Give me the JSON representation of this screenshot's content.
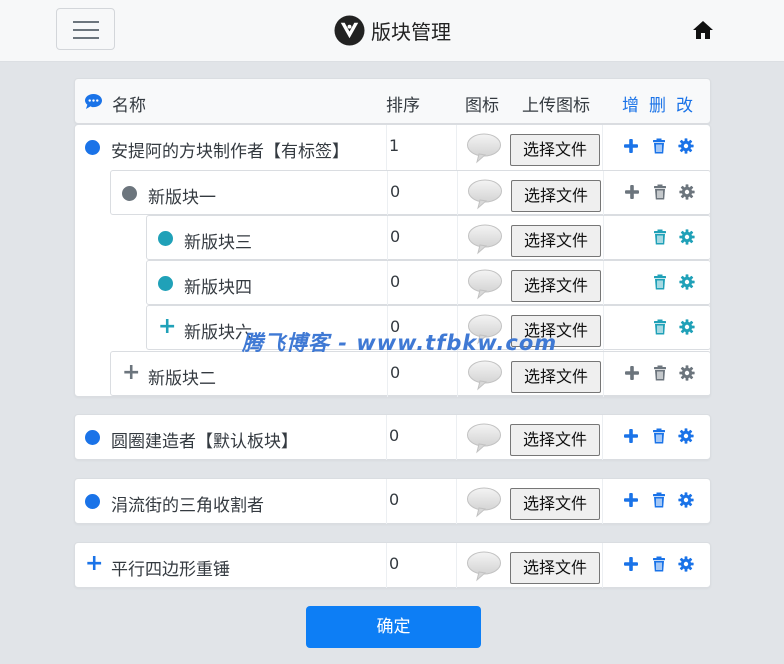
{
  "header": {
    "title": "版块管理"
  },
  "table_head": {
    "name": "名称",
    "order": "排序",
    "icon": "图标",
    "upload": "上传图标",
    "add": "增",
    "delete": "删",
    "edit": "改"
  },
  "rows": [
    {
      "name": "安提阿的方块制作者【有标签】",
      "order": "1",
      "file_label": "选择文件",
      "marker_color": "#1a73e8"
    },
    {
      "name": "新版块一",
      "order": "0",
      "file_label": "选择文件",
      "marker_color": "#6c757d"
    },
    {
      "name": "新版块三",
      "order": "0",
      "file_label": "选择文件",
      "marker_color": "#20a1b8"
    },
    {
      "name": "新版块四",
      "order": "0",
      "file_label": "选择文件",
      "marker_color": "#20a1b8"
    },
    {
      "name": "新版块六",
      "order": "0",
      "file_label": "选择文件",
      "marker_color": "#20a1b8"
    },
    {
      "name": "新版块二",
      "order": "0",
      "file_label": "选择文件",
      "marker_color": "#6c757d"
    },
    {
      "name": "圆圈建造者【默认板块】",
      "order": "0",
      "file_label": "选择文件",
      "marker_color": "#1a73e8"
    },
    {
      "name": "涓流街的三角收割者",
      "order": "0",
      "file_label": "选择文件",
      "marker_color": "#1a73e8"
    },
    {
      "name": "平行四边形重锤",
      "order": "0",
      "file_label": "选择文件",
      "marker_color": "#1a73e8"
    }
  ],
  "confirm_label": "确定",
  "watermark": "腾飞博客 - www.tfbkw.com",
  "colors": {
    "accent": "#1a73e8",
    "teal": "#20a1b8",
    "gray": "#6c757d",
    "button": "#0d7ef5"
  }
}
